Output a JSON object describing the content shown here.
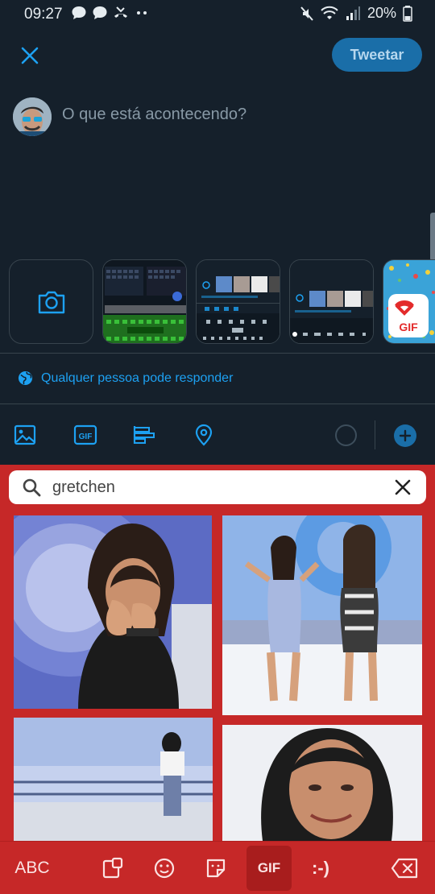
{
  "status_bar": {
    "time": "09:27",
    "battery": "20%",
    "left_icons": [
      "chat-bubble-icon",
      "chat-bubble-icon",
      "missed-call-icon",
      "more-dots-icon"
    ],
    "right_icons": [
      "mute-icon",
      "wifi-icon",
      "signal-icon",
      "battery-icon"
    ]
  },
  "compose": {
    "close_icon": "close-icon",
    "tweet_button": "Tweetar",
    "placeholder": "O que está acontecendo?"
  },
  "media_strip": {
    "camera_icon": "camera-icon",
    "thumbnails": [
      "keyboard-screenshot",
      "keyboard-screenshot",
      "keyboard-screenshot",
      "gif-app-thumbnail"
    ],
    "gif_badge": "GIF"
  },
  "reply_setting": {
    "icon": "globe-icon",
    "label": "Qualquer pessoa pode responder"
  },
  "toolbar": {
    "items": [
      "image-icon",
      "gif-icon",
      "poll-icon",
      "location-icon"
    ],
    "gif_label": "GIF",
    "accent": "#1da1f2"
  },
  "gif_keyboard": {
    "search_value": "gretchen",
    "search_icon": "search-icon",
    "clear_icon": "close-icon",
    "results": [
      "gif-result",
      "gif-result",
      "gif-result",
      "gif-result"
    ],
    "bar": {
      "abc": "ABC",
      "gif": "GIF",
      "emoticon": ":-)",
      "icons": [
        "clipboard-icon",
        "emoji-icon",
        "sticker-icon",
        "backspace-icon"
      ]
    },
    "background": "#c62828"
  }
}
